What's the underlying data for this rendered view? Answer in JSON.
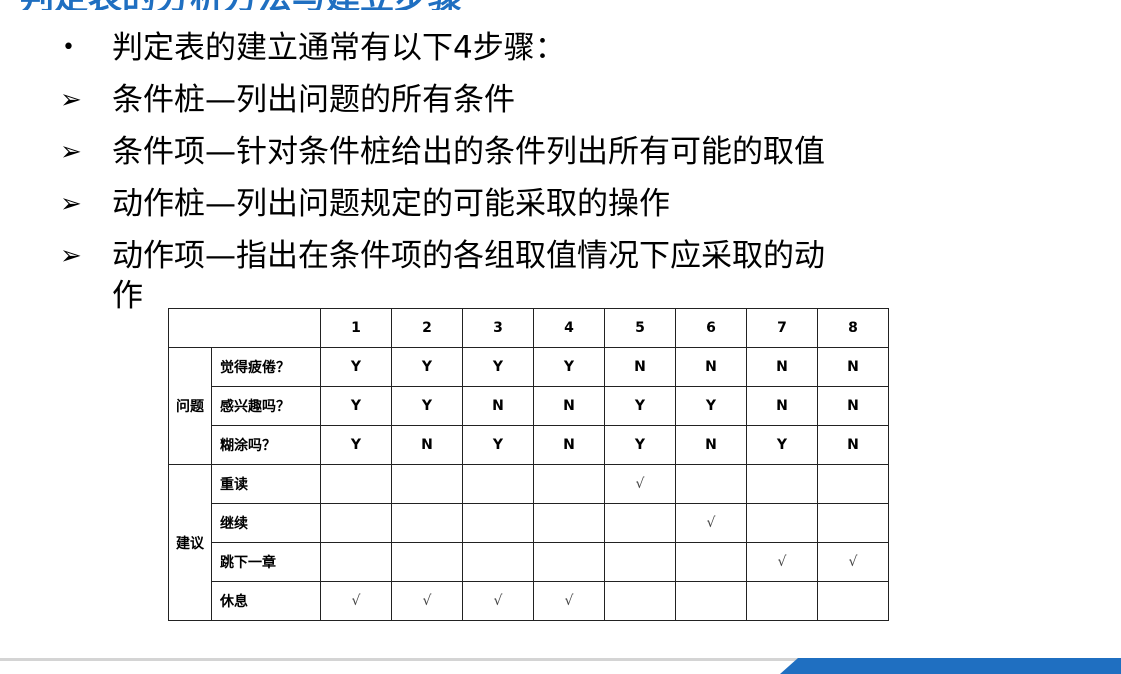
{
  "slide": {
    "title_partial": "判定表的分析方法与建立步骤",
    "intro": "判定表的建立通常有以下4步骤：",
    "steps": [
      "条件桩—列出问题的所有条件",
      "条件项—针对条件桩给出的条件列出所有可能的取值",
      "动作桩—列出问题规定的可能采取的操作",
      "动作项—指出在条件项的各组取值情况下应采取的动"
    ],
    "step4_continuation": "作",
    "bullet_dot": "•",
    "bullet_arrow": "➢"
  },
  "table": {
    "columns": [
      "1",
      "2",
      "3",
      "4",
      "5",
      "6",
      "7",
      "8"
    ],
    "question_group": "问题",
    "advice_group": "建议",
    "questions": [
      {
        "label": "觉得疲倦？",
        "values": [
          "Y",
          "Y",
          "Y",
          "Y",
          "N",
          "N",
          "N",
          "N"
        ]
      },
      {
        "label": "感兴趣吗？",
        "values": [
          "Y",
          "Y",
          "N",
          "N",
          "Y",
          "Y",
          "N",
          "N"
        ]
      },
      {
        "label": "糊涂吗？",
        "values": [
          "Y",
          "N",
          "Y",
          "N",
          "Y",
          "N",
          "Y",
          "N"
        ]
      }
    ],
    "actions": [
      {
        "label": "重读",
        "values": [
          "",
          "",
          "",
          "",
          "√",
          "",
          "",
          ""
        ]
      },
      {
        "label": "继续",
        "values": [
          "",
          "",
          "",
          "",
          "",
          "√",
          "",
          ""
        ]
      },
      {
        "label": "跳下一章",
        "values": [
          "",
          "",
          "",
          "",
          "",
          "",
          "√",
          "√"
        ]
      },
      {
        "label": "休息",
        "values": [
          "√",
          "√",
          "√",
          "√",
          "",
          "",
          "",
          ""
        ]
      }
    ]
  },
  "colors": {
    "accent": "#1f6fc1",
    "divider": "#d4d4d4"
  }
}
